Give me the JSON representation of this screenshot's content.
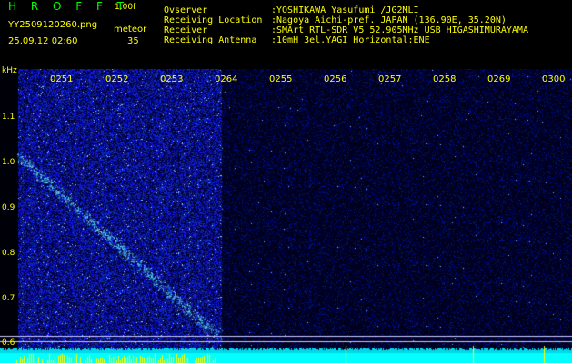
{
  "header": {
    "brand": "H R O F F T",
    "version": "1.00f",
    "filename": "YY2509120260.png",
    "mode": "meteor",
    "timestamp": "25.09.12 02:60",
    "count": "35"
  },
  "info": [
    {
      "label": "Ovserver",
      "value": ":YOSHIKAWA Yasufumi /JG2MLI"
    },
    {
      "label": "Receiving Location",
      "value": ":Nagoya Aichi-pref. JAPAN (136.90E, 35.20N)"
    },
    {
      "label": "Receiver",
      "value": ":SMArt RTL-SDR V5 52.905MHz USB HIGASHIMURAYAMA"
    },
    {
      "label": "Receiving Antenna",
      "value": ":10mH 3el.YAGI Horizontal:ENE"
    }
  ],
  "axis": {
    "unit": "kHz",
    "y_ticks": [
      "1.1",
      "1.0",
      "0.9",
      "0.8",
      "0.7",
      "0.6"
    ],
    "x_ticks": [
      "0251",
      "0252",
      "0253",
      "0264",
      "0255",
      "0256",
      "0257",
      "0258",
      "0269",
      "0300"
    ]
  },
  "colors": {
    "label": "#ffff00",
    "brand": "#00ff00",
    "noise_bright": "#2b4bff",
    "noise_dark": "#0a0f6e",
    "trail": "#40e0ff",
    "baseline": "#00ffff"
  }
}
